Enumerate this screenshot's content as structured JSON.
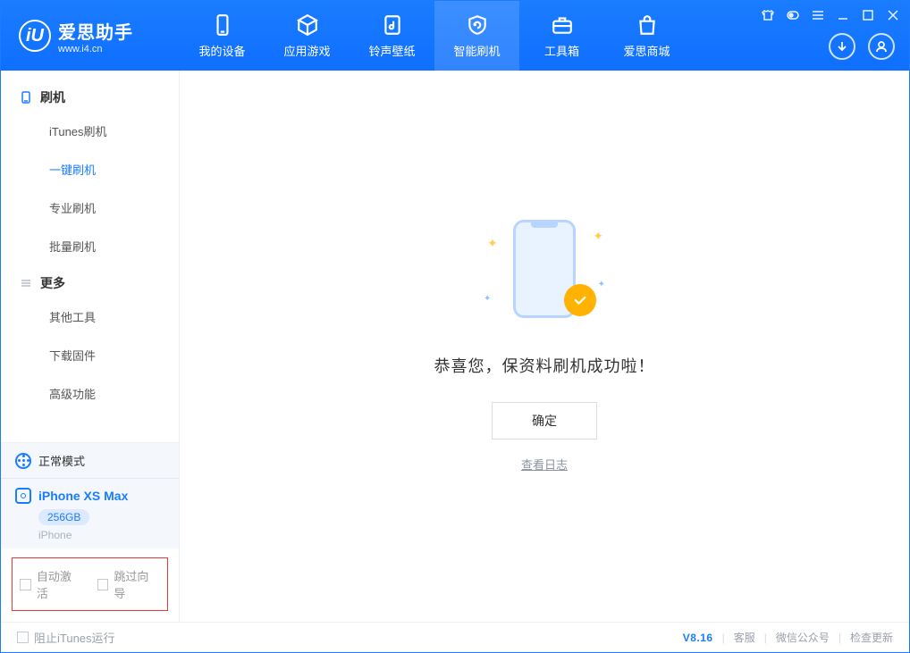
{
  "app": {
    "name": "爱思助手",
    "url": "www.i4.cn"
  },
  "tabs": [
    {
      "label": "我的设备"
    },
    {
      "label": "应用游戏"
    },
    {
      "label": "铃声壁纸"
    },
    {
      "label": "智能刷机"
    },
    {
      "label": "工具箱"
    },
    {
      "label": "爱思商城"
    }
  ],
  "sidebar": {
    "group_flash": "刷机",
    "items_flash": [
      {
        "label": "iTunes刷机"
      },
      {
        "label": "一键刷机"
      },
      {
        "label": "专业刷机"
      },
      {
        "label": "批量刷机"
      }
    ],
    "group_more": "更多",
    "items_more": [
      {
        "label": "其他工具"
      },
      {
        "label": "下载固件"
      },
      {
        "label": "高级功能"
      }
    ]
  },
  "mode": {
    "label": "正常模式"
  },
  "device": {
    "name": "iPhone XS Max",
    "capacity": "256GB",
    "type": "iPhone"
  },
  "options": {
    "auto_activate": "自动激活",
    "skip_guide": "跳过向导"
  },
  "main": {
    "success_message": "恭喜您，保资料刷机成功啦！",
    "ok_button": "确定",
    "view_log": "查看日志"
  },
  "statusbar": {
    "block_itunes": "阻止iTunes运行",
    "version": "V8.16",
    "links": {
      "support": "客服",
      "wechat": "微信公众号",
      "update": "检查更新"
    }
  }
}
